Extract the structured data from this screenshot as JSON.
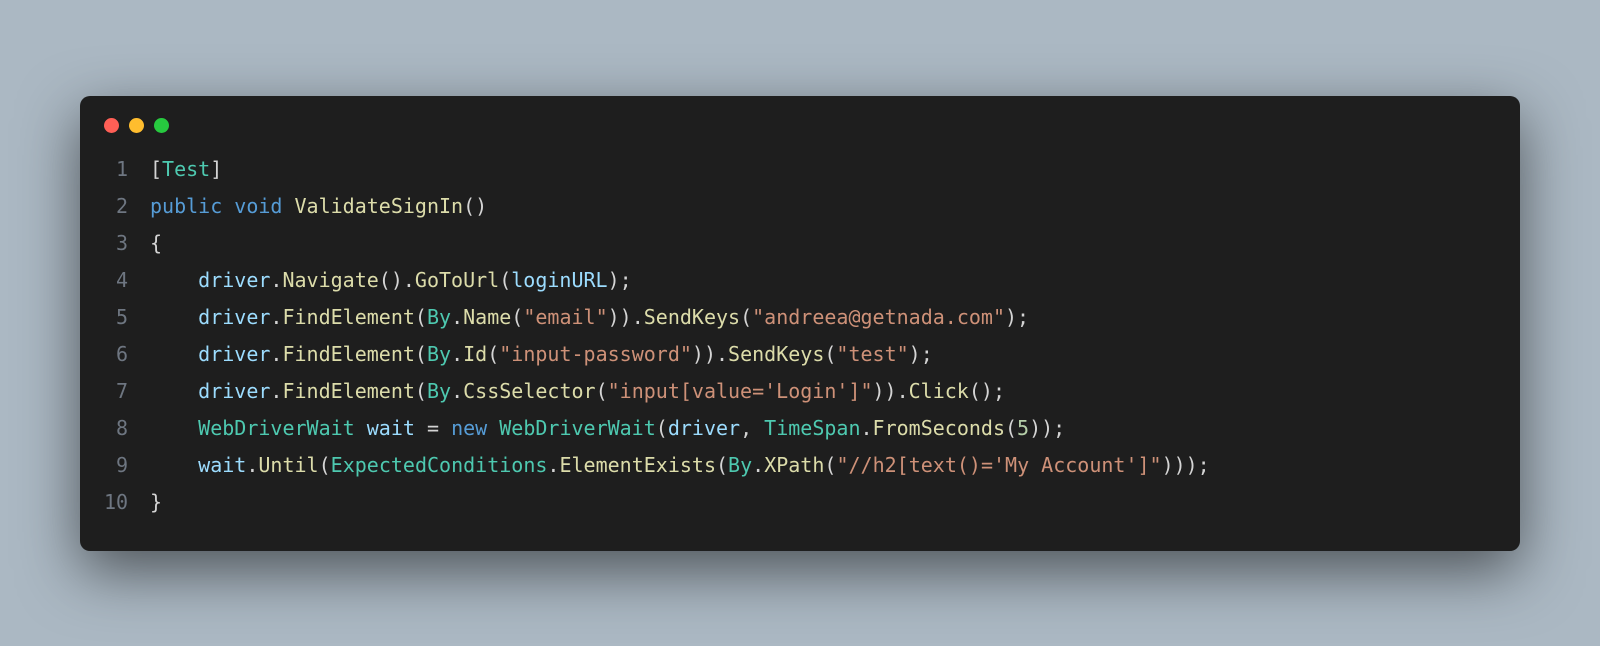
{
  "window": {
    "dots": {
      "red": "#ff5f56",
      "yellow": "#ffbd2e",
      "green": "#27c93f"
    }
  },
  "code": {
    "lines": [
      {
        "n": "1",
        "indent": "",
        "tokens": [
          {
            "t": "[",
            "c": "c-punct"
          },
          {
            "t": "Test",
            "c": "c-type"
          },
          {
            "t": "]",
            "c": "c-punct"
          }
        ]
      },
      {
        "n": "2",
        "indent": "",
        "tokens": [
          {
            "t": "public",
            "c": "c-keyword"
          },
          {
            "t": " ",
            "c": "c-plain"
          },
          {
            "t": "void",
            "c": "c-keyword"
          },
          {
            "t": " ",
            "c": "c-plain"
          },
          {
            "t": "ValidateSignIn",
            "c": "c-method"
          },
          {
            "t": "()",
            "c": "c-punct"
          }
        ]
      },
      {
        "n": "3",
        "indent": "",
        "tokens": [
          {
            "t": "{",
            "c": "c-punct"
          }
        ]
      },
      {
        "n": "4",
        "indent": "    ",
        "tokens": [
          {
            "t": "driver",
            "c": "c-var"
          },
          {
            "t": ".",
            "c": "c-punct"
          },
          {
            "t": "Navigate",
            "c": "c-method"
          },
          {
            "t": "().",
            "c": "c-punct"
          },
          {
            "t": "GoToUrl",
            "c": "c-method"
          },
          {
            "t": "(",
            "c": "c-punct"
          },
          {
            "t": "loginURL",
            "c": "c-var"
          },
          {
            "t": ");",
            "c": "c-punct"
          }
        ]
      },
      {
        "n": "5",
        "indent": "    ",
        "tokens": [
          {
            "t": "driver",
            "c": "c-var"
          },
          {
            "t": ".",
            "c": "c-punct"
          },
          {
            "t": "FindElement",
            "c": "c-method"
          },
          {
            "t": "(",
            "c": "c-punct"
          },
          {
            "t": "By",
            "c": "c-type"
          },
          {
            "t": ".",
            "c": "c-punct"
          },
          {
            "t": "Name",
            "c": "c-method"
          },
          {
            "t": "(",
            "c": "c-punct"
          },
          {
            "t": "\"email\"",
            "c": "c-string"
          },
          {
            "t": ")).",
            "c": "c-punct"
          },
          {
            "t": "SendKeys",
            "c": "c-method"
          },
          {
            "t": "(",
            "c": "c-punct"
          },
          {
            "t": "\"andreea@getnada.com\"",
            "c": "c-string"
          },
          {
            "t": ");",
            "c": "c-punct"
          }
        ]
      },
      {
        "n": "6",
        "indent": "    ",
        "tokens": [
          {
            "t": "driver",
            "c": "c-var"
          },
          {
            "t": ".",
            "c": "c-punct"
          },
          {
            "t": "FindElement",
            "c": "c-method"
          },
          {
            "t": "(",
            "c": "c-punct"
          },
          {
            "t": "By",
            "c": "c-type"
          },
          {
            "t": ".",
            "c": "c-punct"
          },
          {
            "t": "Id",
            "c": "c-method"
          },
          {
            "t": "(",
            "c": "c-punct"
          },
          {
            "t": "\"input-password\"",
            "c": "c-string"
          },
          {
            "t": ")).",
            "c": "c-punct"
          },
          {
            "t": "SendKeys",
            "c": "c-method"
          },
          {
            "t": "(",
            "c": "c-punct"
          },
          {
            "t": "\"test\"",
            "c": "c-string"
          },
          {
            "t": ");",
            "c": "c-punct"
          }
        ]
      },
      {
        "n": "7",
        "indent": "    ",
        "tokens": [
          {
            "t": "driver",
            "c": "c-var"
          },
          {
            "t": ".",
            "c": "c-punct"
          },
          {
            "t": "FindElement",
            "c": "c-method"
          },
          {
            "t": "(",
            "c": "c-punct"
          },
          {
            "t": "By",
            "c": "c-type"
          },
          {
            "t": ".",
            "c": "c-punct"
          },
          {
            "t": "CssSelector",
            "c": "c-method"
          },
          {
            "t": "(",
            "c": "c-punct"
          },
          {
            "t": "\"input[value='Login']\"",
            "c": "c-string"
          },
          {
            "t": ")).",
            "c": "c-punct"
          },
          {
            "t": "Click",
            "c": "c-method"
          },
          {
            "t": "();",
            "c": "c-punct"
          }
        ]
      },
      {
        "n": "8",
        "indent": "    ",
        "tokens": [
          {
            "t": "WebDriverWait",
            "c": "c-type"
          },
          {
            "t": " ",
            "c": "c-plain"
          },
          {
            "t": "wait",
            "c": "c-var"
          },
          {
            "t": " = ",
            "c": "c-punct"
          },
          {
            "t": "new",
            "c": "c-keyword"
          },
          {
            "t": " ",
            "c": "c-plain"
          },
          {
            "t": "WebDriverWait",
            "c": "c-type"
          },
          {
            "t": "(",
            "c": "c-punct"
          },
          {
            "t": "driver",
            "c": "c-var"
          },
          {
            "t": ", ",
            "c": "c-punct"
          },
          {
            "t": "TimeSpan",
            "c": "c-type"
          },
          {
            "t": ".",
            "c": "c-punct"
          },
          {
            "t": "FromSeconds",
            "c": "c-method"
          },
          {
            "t": "(",
            "c": "c-punct"
          },
          {
            "t": "5",
            "c": "c-number"
          },
          {
            "t": "));",
            "c": "c-punct"
          }
        ]
      },
      {
        "n": "9",
        "indent": "    ",
        "tokens": [
          {
            "t": "wait",
            "c": "c-var"
          },
          {
            "t": ".",
            "c": "c-punct"
          },
          {
            "t": "Until",
            "c": "c-method"
          },
          {
            "t": "(",
            "c": "c-punct"
          },
          {
            "t": "ExpectedConditions",
            "c": "c-type"
          },
          {
            "t": ".",
            "c": "c-punct"
          },
          {
            "t": "ElementExists",
            "c": "c-method"
          },
          {
            "t": "(",
            "c": "c-punct"
          },
          {
            "t": "By",
            "c": "c-type"
          },
          {
            "t": ".",
            "c": "c-punct"
          },
          {
            "t": "XPath",
            "c": "c-method"
          },
          {
            "t": "(",
            "c": "c-punct"
          },
          {
            "t": "\"//h2[text()='My Account']\"",
            "c": "c-string"
          },
          {
            "t": ")));",
            "c": "c-punct"
          }
        ]
      },
      {
        "n": "10",
        "indent": "",
        "tokens": [
          {
            "t": "}",
            "c": "c-punct"
          }
        ]
      }
    ]
  }
}
